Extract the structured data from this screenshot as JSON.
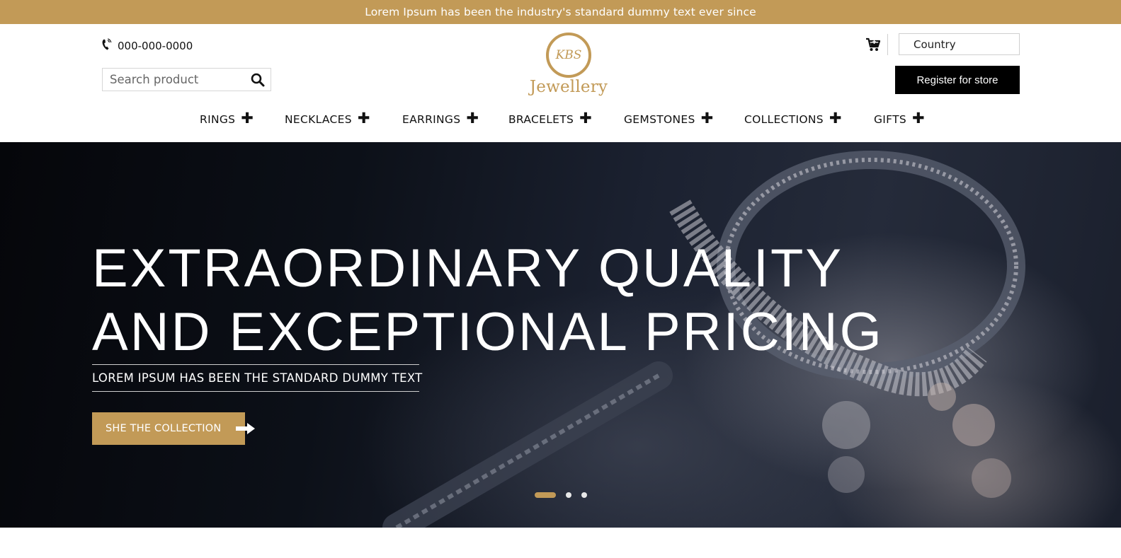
{
  "announcement": {
    "text": "Lorem Ipsum has been the industry's standard dummy text ever since"
  },
  "header": {
    "phone": {
      "icon": "phone-icon",
      "number": "000-000-0000"
    },
    "search": {
      "placeholder": "Search product",
      "value": "",
      "icon": "search-icon"
    },
    "logo": {
      "monogram": "KBS",
      "wordmark": "Jewellery"
    },
    "cart": {
      "icon": "cart-icon"
    },
    "country": {
      "label": "Country"
    },
    "register_button": "Register for store"
  },
  "nav": {
    "items": [
      {
        "label": "RINGS"
      },
      {
        "label": "NECKLACES"
      },
      {
        "label": "EARRINGS"
      },
      {
        "label": "BRACELETS"
      },
      {
        "label": "GEMSTONES"
      },
      {
        "label": "COLLECTIONS"
      },
      {
        "label": "GIFTS"
      }
    ],
    "expand_glyph": "✚"
  },
  "hero": {
    "headline_line1": "EXTRAORDINARY QUALITY",
    "headline_line2": "AND EXCEPTIONAL PRICING",
    "subline": "LOREM IPSUM HAS BEEN THE STANDARD DUMMY TEXT",
    "cta_label": "SHE THE COLLECTION",
    "cta_icon": "arrow-right-icon",
    "slides": {
      "count": 3,
      "active": 1
    }
  },
  "colors": {
    "accent": "#c29a57",
    "dark": "#000000",
    "text": "#111111"
  }
}
